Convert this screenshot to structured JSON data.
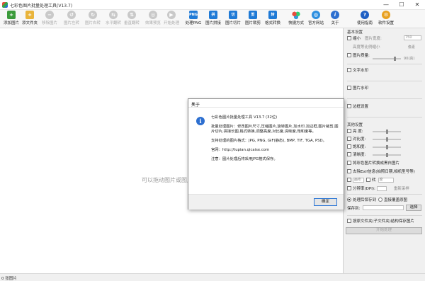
{
  "window": {
    "title": "七彩色图片批量处理工具(V13.7)",
    "controls": [
      "—",
      "☐",
      "✕"
    ]
  },
  "toolbar": {
    "items": [
      {
        "label": "添加图片",
        "icon": "add-image-icon",
        "glyph": "+",
        "enabled": true
      },
      {
        "label": "添文件夹",
        "icon": "add-folder-icon",
        "glyph": "+",
        "enabled": true
      },
      {
        "label": "移除图片",
        "icon": "remove-image-icon",
        "glyph": "−",
        "enabled": false
      },
      {
        "label": "图片左转",
        "icon": "rotate-left-icon",
        "glyph": "↺",
        "enabled": false
      },
      {
        "label": "图片右转",
        "icon": "rotate-right-icon",
        "glyph": "↻",
        "enabled": false
      },
      {
        "label": "水平翻转",
        "icon": "flip-horizontal-icon",
        "glyph": "⇆",
        "enabled": false
      },
      {
        "label": "垂直翻转",
        "icon": "flip-vertical-icon",
        "glyph": "⇅",
        "enabled": false
      },
      {
        "label": "效果预览",
        "icon": "preview-icon",
        "glyph": "◎",
        "enabled": false
      },
      {
        "label": "开始处理",
        "icon": "start-icon",
        "glyph": "▶",
        "enabled": false
      },
      {
        "label": "处理PNG",
        "icon": "png-icon",
        "glyph": "PNG",
        "enabled": true
      },
      {
        "label": "图片拼接",
        "icon": "stitch-icon",
        "glyph": "拼",
        "enabled": true
      },
      {
        "label": "图片切片",
        "icon": "slice-icon",
        "glyph": "切",
        "enabled": true
      },
      {
        "label": "图片裁剪",
        "icon": "crop-icon",
        "glyph": "剪",
        "enabled": true
      },
      {
        "label": "格式转换",
        "icon": "convert-icon",
        "glyph": "转",
        "enabled": true
      },
      {
        "label": "快捷方式",
        "icon": "shortcut-icon",
        "glyph": "",
        "enabled": true
      },
      {
        "label": "官方网站",
        "icon": "website-icon",
        "glyph": "◍",
        "enabled": true
      },
      {
        "label": "关于",
        "icon": "about-icon",
        "glyph": "i",
        "enabled": true
      },
      {
        "label": "使用指南",
        "icon": "help-icon",
        "glyph": "?",
        "enabled": true
      },
      {
        "label": "软件设置",
        "icon": "settings-icon",
        "glyph": "⚙",
        "enabled": true
      }
    ]
  },
  "canvas": {
    "drop_hint": "可以拖动图片或图片文"
  },
  "status": {
    "text": "0 张图片"
  },
  "panel": {
    "basic_title": "基本设置",
    "scale_label": "缩小",
    "scale_field": "图片宽度:",
    "scale_value": "750",
    "height_ratio_label": "高度等比例缩小",
    "height_unit": "像素",
    "quality_label": "图片质量:",
    "quality_value": "90(高)",
    "text_watermark": "文字水印",
    "image_watermark": "图片水印",
    "border_settings": "边框设置",
    "other_title": "其他设置",
    "brightness": "亮 度:",
    "contrast": "对比度:",
    "saturation": "饱和度:",
    "sharpness": "清晰度:",
    "grayscale": "将彩色图片转换成黑白图片",
    "keep_exif": "去除Exif信息(拍照日期,相机型号等)",
    "canvas_size": "画布",
    "rotate": "转",
    "rotate_unit": "度",
    "rename": "分辨率(DPI):",
    "reset": "重新采样",
    "save_to": "处理后保存到",
    "overwrite": "直接覆盖原图",
    "save_path_label": "保存到:",
    "browse": "选择",
    "keep_structure": "按原文件夹(子文件夹)结构保存图片",
    "start": "开始处理"
  },
  "dialog": {
    "title": "关于",
    "close": "✕",
    "app_line": "七彩色图片批量处理工具 V13.7 (32位)",
    "features": "批量处理图片：修改图片尺寸,压缩图片,旋转图片,加水印,加边框,图片裁剪,图片切片,拼接长图,格式转换,调整亮度,对比度,清晰度,饱和度等。",
    "formats": "支持处理的图片格式：JPG, PNG, GIF(静态), BMP, TIF, TGA, PSD。",
    "website": "官网：http://tupian.qicaise.com",
    "note": "注意：图片处理后将采用JPG格式保存。",
    "ok": "确定"
  },
  "colors": {
    "accent_blue": "#1f7ad6",
    "add_green": "#3b9b3b",
    "folder_yellow": "#e9b43b",
    "disabled_gray": "#a8a8a8"
  }
}
